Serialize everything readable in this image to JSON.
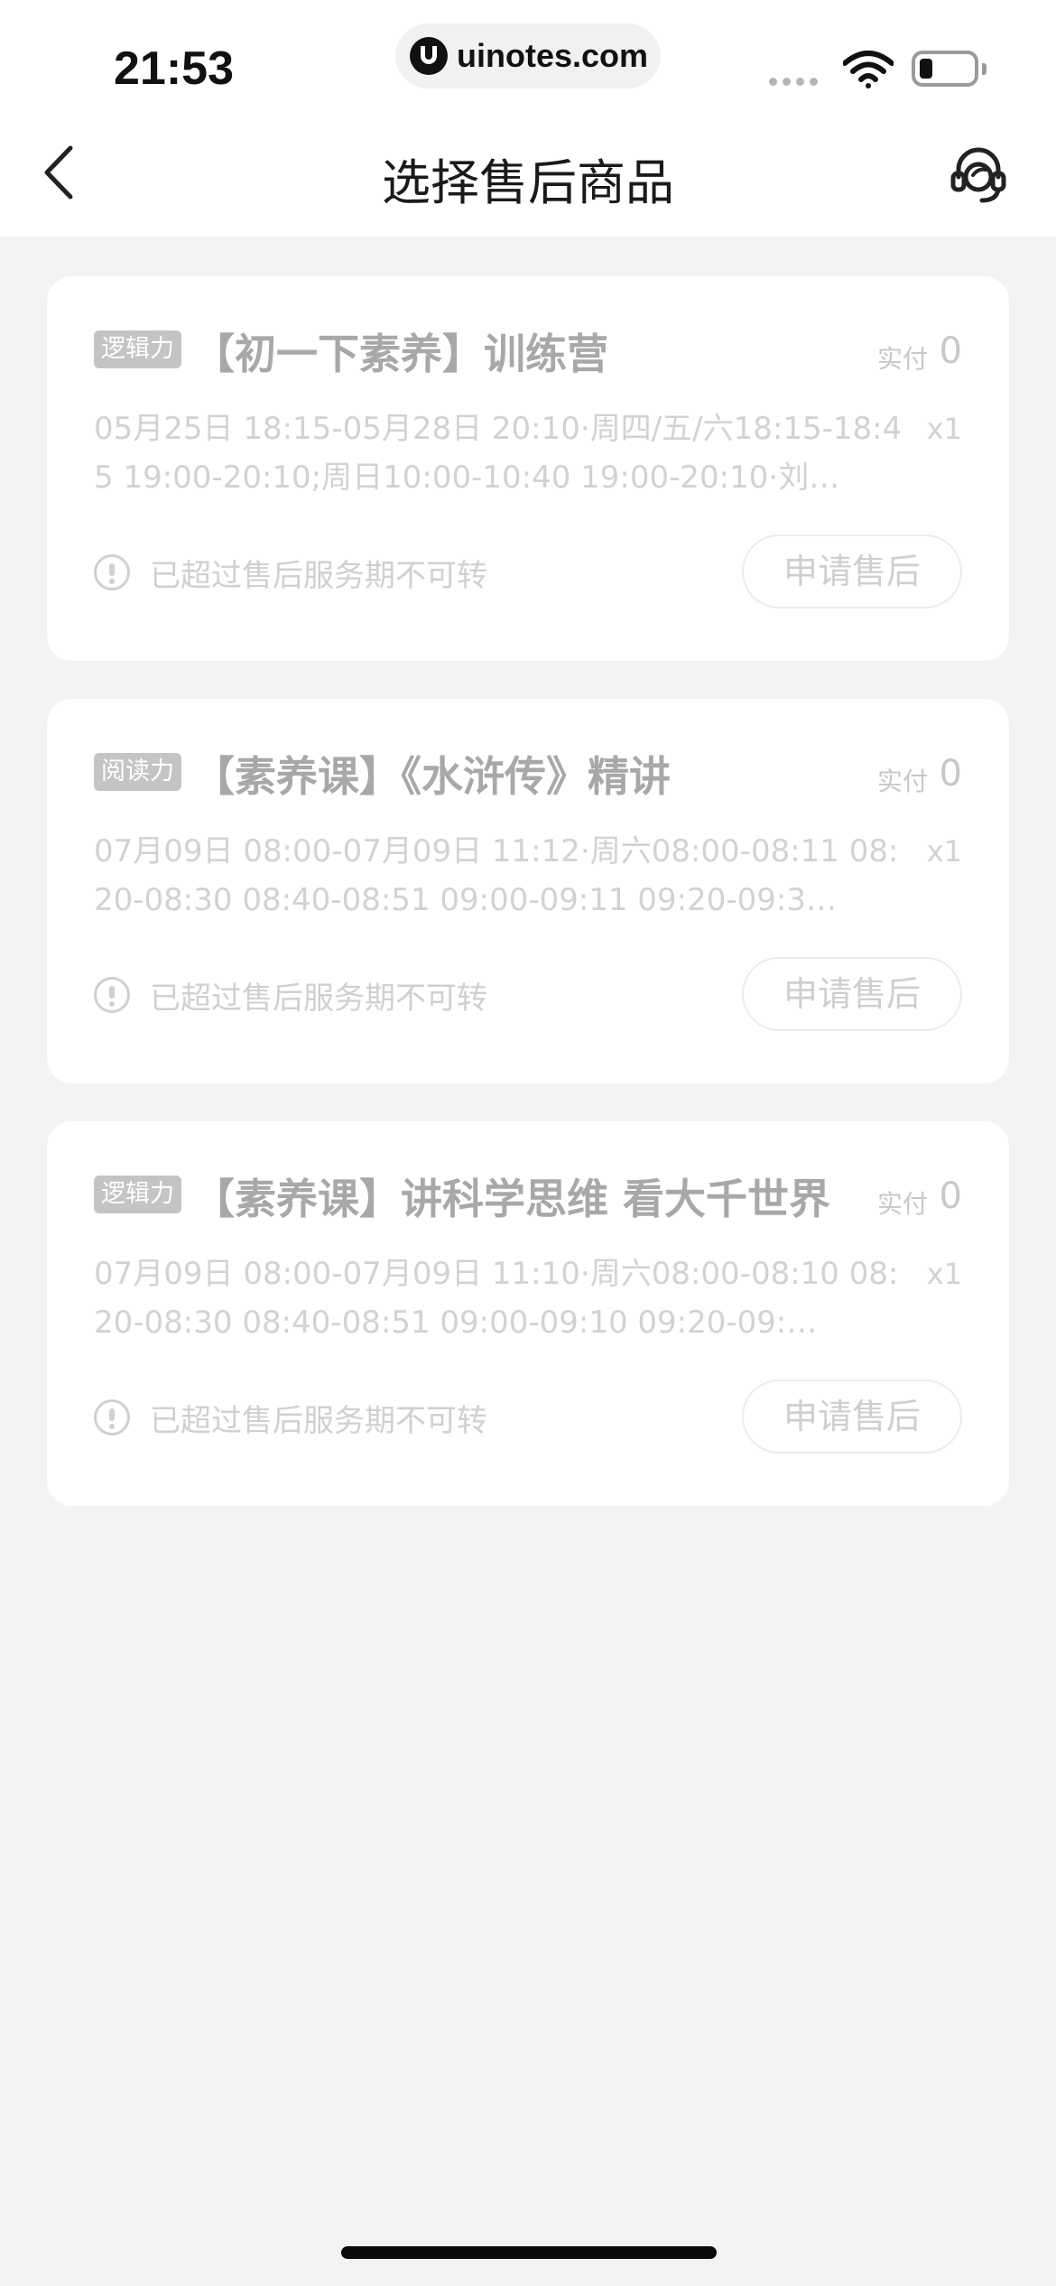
{
  "status_bar": {
    "time": "21:53",
    "url": "uinotes.com"
  },
  "nav": {
    "title": "选择售后商品",
    "back_icon": "chevron-left-icon",
    "service_icon": "customer-service-icon"
  },
  "orders": [
    {
      "tag": "逻辑力",
      "title": "【初一下素养】训练营",
      "paid_label": "实付",
      "paid_amount": "0",
      "description": "05月25日 18:15-05月28日 20:10·周四/五/六18:15-18:45 19:00-20:10;周日10:00-10:40 19:00-20:10·刘…",
      "quantity": "x1",
      "notice": "已超过售后服务期不可转",
      "action": "申请售后"
    },
    {
      "tag": "阅读力",
      "title": "【素养课】《水浒传》精讲",
      "paid_label": "实付",
      "paid_amount": "0",
      "description": "07月09日 08:00-07月09日 11:12·周六08:00-08:11 08:20-08:30 08:40-08:51 09:00-09:11 09:20-09:3…",
      "quantity": "x1",
      "notice": "已超过售后服务期不可转",
      "action": "申请售后"
    },
    {
      "tag": "逻辑力",
      "title": "【素养课】讲科学思维 看大千世界",
      "paid_label": "实付",
      "paid_amount": "0",
      "description": "07月09日 08:00-07月09日 11:10·周六08:00-08:10 08:20-08:30 08:40-08:51 09:00-09:10 09:20-09:…",
      "quantity": "x1",
      "notice": "已超过售后服务期不可转",
      "action": "申请售后"
    }
  ]
}
